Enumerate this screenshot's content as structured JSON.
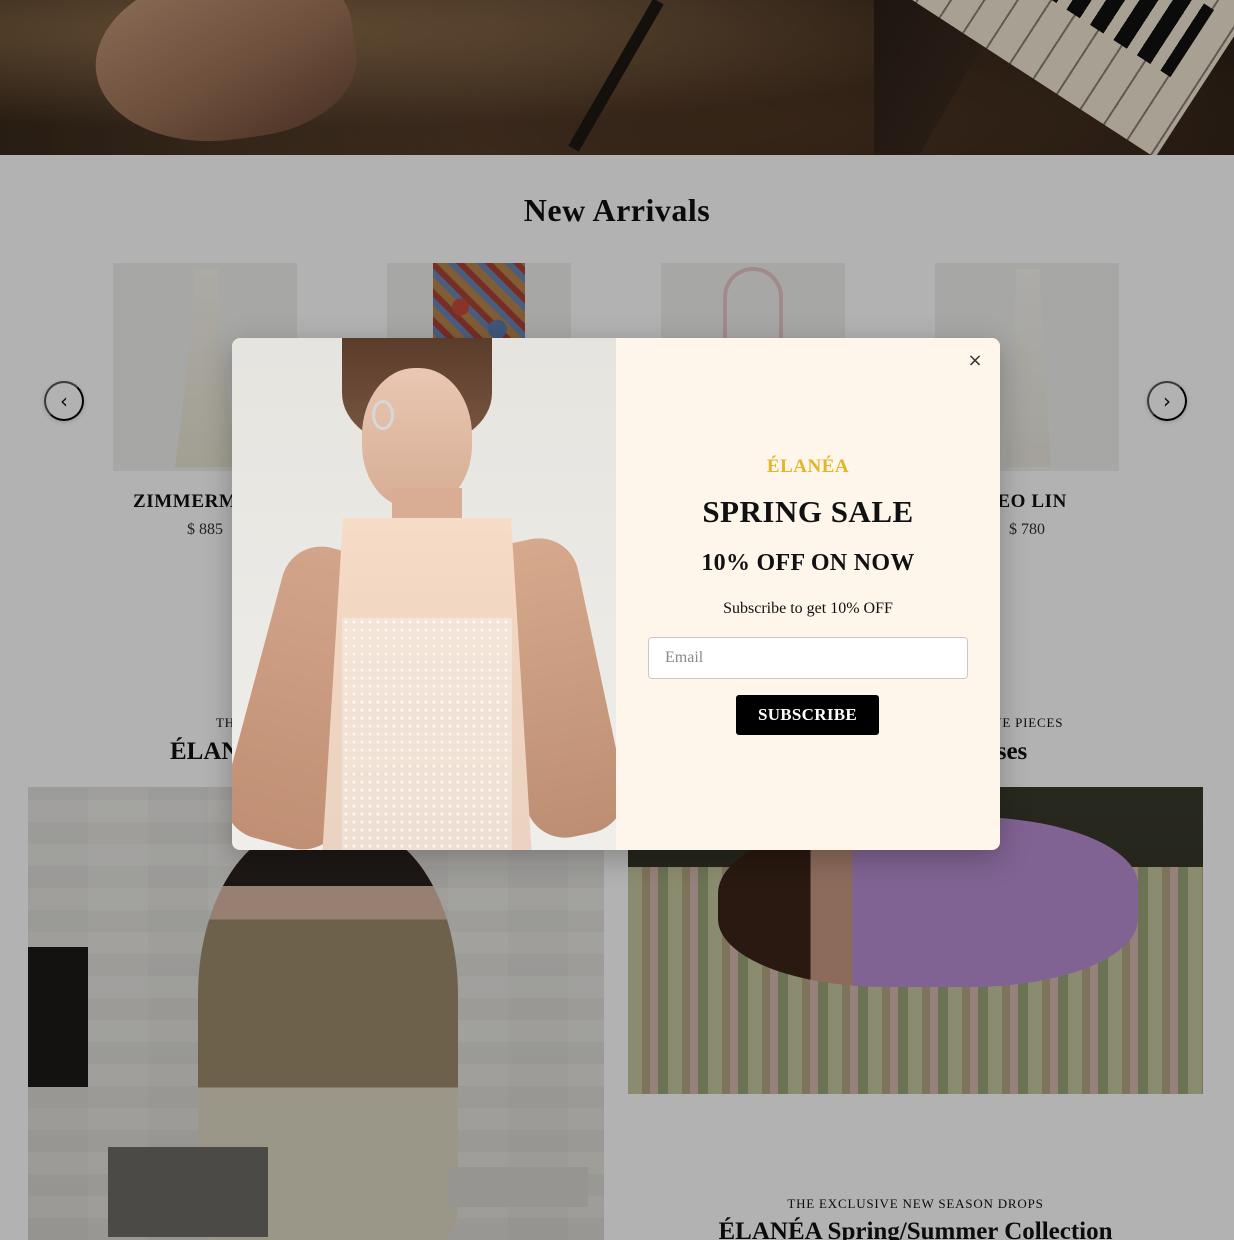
{
  "new_arrivals": {
    "title": "New Arrivals",
    "products": [
      {
        "brand": "ZIMMERM",
        "price": "$ 885"
      },
      {
        "brand": "",
        "price": ""
      },
      {
        "brand": "",
        "price": ""
      },
      {
        "brand": "EO LIN",
        "price": "$ 780"
      }
    ]
  },
  "features": {
    "left": {
      "eyebrow": "TH",
      "title": "ÉLAN"
    },
    "right": {
      "eyebrow": "IVE PIECES",
      "title": "sses"
    },
    "bottom": {
      "eyebrow": "THE EXCLUSIVE NEW SEASON DROPS",
      "title": "ÉLANÉA Spring/Summer Collection"
    }
  },
  "popup": {
    "close_symbol": "×",
    "brand": "ÉLANÉA",
    "headline": "SPRING SALE",
    "offer": "10% OFF ON NOW",
    "subtext": "Subscribe to get 10% OFF",
    "email_placeholder": "Email",
    "email_value": "",
    "subscribe_label": "SUBSCRIBE"
  },
  "colors": {
    "brand_accent": "#e1b62a",
    "popup_background": "#fff6eb",
    "button_background": "#000000",
    "overlay": "rgba(0,0,0,0.3)"
  },
  "icons": {
    "carousel_prev": "chevron-left-icon",
    "carousel_next": "chevron-right-icon",
    "close": "close-icon"
  }
}
